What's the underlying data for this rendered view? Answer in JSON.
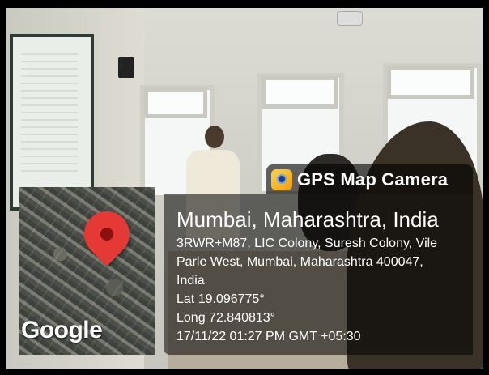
{
  "overlay": {
    "app_title": "GPS Map Camera",
    "app_icon": "map-camera-icon",
    "location": "Mumbai, Maharashtra, India",
    "address_line1": "3RWR+M87, LIC Colony, Suresh Colony, Vile",
    "address_line2": "Parle West, Mumbai, Maharashtra 400047,",
    "address_line3": "India",
    "lat": "Lat 19.096775°",
    "long": "Long 72.840813°",
    "datetime": "17/11/22 01:27 PM GMT +05:30",
    "map_brand": "Google"
  },
  "colors": {
    "pin": "#e53935",
    "overlay_bg": "rgba(0,0,0,0.55)"
  }
}
